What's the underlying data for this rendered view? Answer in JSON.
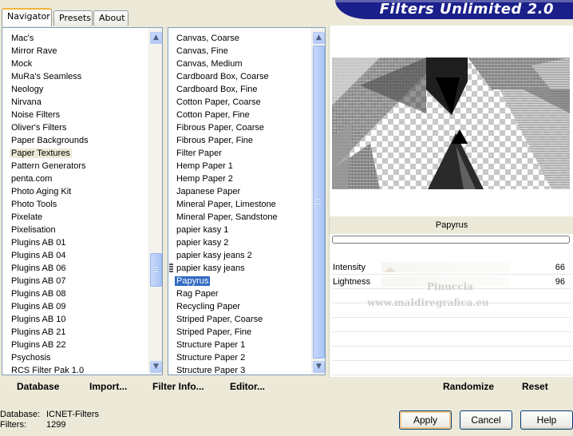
{
  "tabs": [
    {
      "label": "Navigator",
      "active": true
    },
    {
      "label": "Presets",
      "active": false
    },
    {
      "label": "About",
      "active": false
    }
  ],
  "banner_title": "Filters Unlimited 2.0",
  "categories": {
    "items": [
      "Mac's",
      "Mirror Rave",
      "Mock",
      "MuRa's Seamless",
      "Neology",
      "Nirvana",
      "Noise Filters",
      "Oliver's Filters",
      "Paper Backgrounds",
      "Paper Textures",
      "Pattern Generators",
      "penta.com",
      "Photo Aging Kit",
      "Photo Tools",
      "Pixelate",
      "Pixelisation",
      "Plugins AB 01",
      "Plugins AB 04",
      "Plugins AB 06",
      "Plugins AB 07",
      "Plugins AB 08",
      "Plugins AB 09",
      "Plugins AB 10",
      "Plugins AB 21",
      "Plugins AB 22",
      "Psychosis",
      "RCS Filter Pak 1.0"
    ],
    "selected": "Paper Textures"
  },
  "filters": {
    "items": [
      "Canvas, Coarse",
      "Canvas, Fine",
      "Canvas, Medium",
      "Cardboard Box, Coarse",
      "Cardboard Box, Fine",
      "Cotton Paper, Coarse",
      "Cotton Paper, Fine",
      "Fibrous Paper, Coarse",
      "Fibrous Paper, Fine",
      "Filter Paper",
      "Hemp Paper 1",
      "Hemp Paper 2",
      "Japanese Paper",
      "Mineral Paper, Limestone",
      "Mineral Paper, Sandstone",
      "papier kasy 1",
      "papier kasy 2",
      "papier kasy jeans 2",
      "papier kasy jeans",
      "Papyrus",
      "Rag Paper",
      "Recycling Paper",
      "Striped Paper, Coarse",
      "Striped Paper, Fine",
      "Structure Paper 1",
      "Structure Paper 2",
      "Structure Paper 3"
    ],
    "selected": "Papyrus"
  },
  "preview": {
    "filter_name": "Papyrus",
    "progress": 0
  },
  "params": [
    {
      "label": "Intensity",
      "value": "66"
    },
    {
      "label": "Lightness",
      "value": "96"
    }
  ],
  "watermark": {
    "line1": "Pinuccia",
    "line2": "www.maldiregrafica.eu"
  },
  "toolbar": {
    "database": "Database",
    "import": "Import...",
    "filter_info": "Filter Info...",
    "editor": "Editor...",
    "randomize": "Randomize",
    "reset": "Reset"
  },
  "status": {
    "database_label": "Database:",
    "database_value": "ICNET-Filters",
    "filters_label": "Filters:",
    "filters_value": "1299"
  },
  "buttons": {
    "apply": "Apply",
    "cancel": "Cancel",
    "help": "Help"
  },
  "icons": {
    "scroll_up": "chevron-up-icon",
    "scroll_down": "chevron-down-icon"
  }
}
